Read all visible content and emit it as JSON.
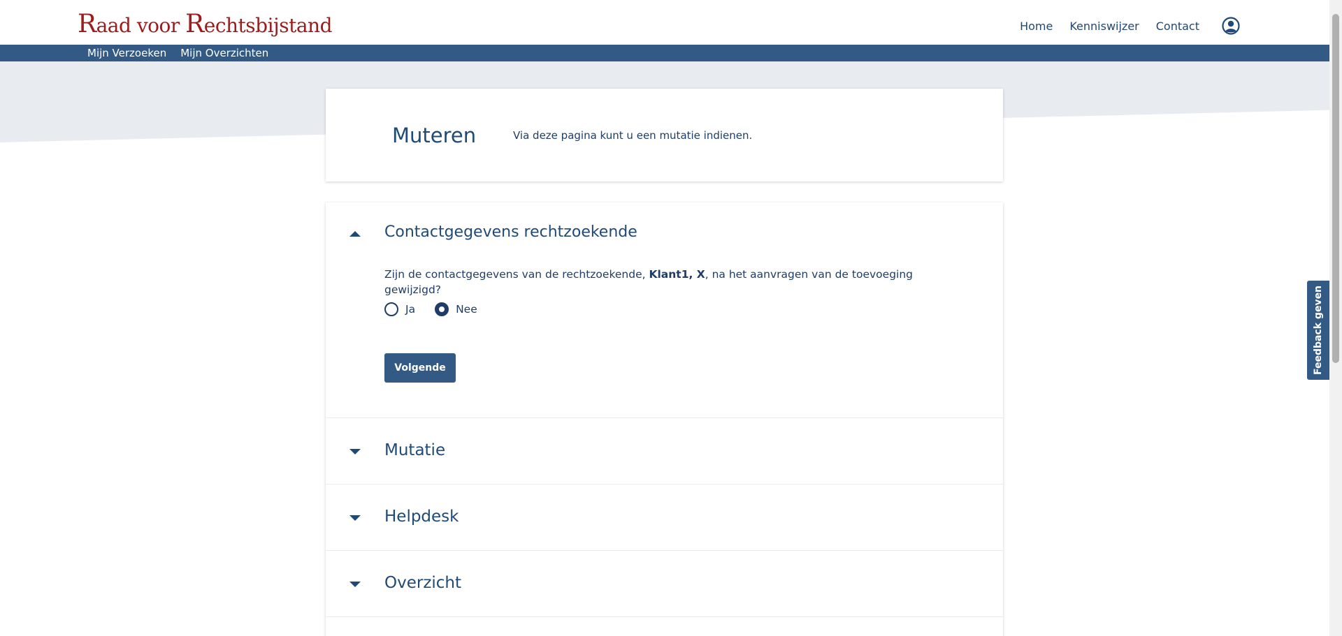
{
  "header": {
    "logo_part1_cap": "R",
    "logo_part1_rest": "aad voor ",
    "logo_part2_cap": "R",
    "logo_part2_rest": "echtsbijstand",
    "nav": [
      {
        "label": "Home"
      },
      {
        "label": "Kenniswijzer"
      },
      {
        "label": "Contact"
      }
    ],
    "user_icon": "user-circle-icon"
  },
  "subnav": {
    "items": [
      {
        "label": "Mijn Verzoeken"
      },
      {
        "label": "Mijn Overzichten"
      }
    ]
  },
  "intro": {
    "title": "Muteren",
    "text": "Via deze pagina kunt u een mutatie indienen."
  },
  "accordion": {
    "contact": {
      "title": "Contactgegevens rechtzoekende",
      "question_before": "Zijn de contactgegevens van de rechtzoekende, ",
      "question_bold": "Klant1, X",
      "question_after": ", na het aanvragen van de toevoeging gewijzigd?",
      "options": [
        {
          "label": "Ja",
          "checked": false
        },
        {
          "label": "Nee",
          "checked": true
        }
      ],
      "next_label": "Volgende"
    },
    "sections": [
      {
        "title": "Mutatie"
      },
      {
        "title": "Helpdesk"
      },
      {
        "title": "Overzicht"
      }
    ]
  },
  "feedback": {
    "label": "Feedback geven"
  },
  "colors": {
    "primary": "#325a84",
    "logo": "#9b1c1c",
    "band": "#e8ecf0"
  }
}
